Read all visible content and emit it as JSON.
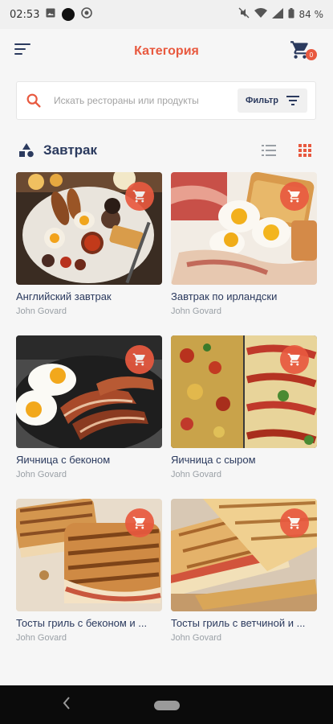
{
  "status_bar": {
    "time": "02:53",
    "battery": "84 %"
  },
  "header": {
    "title": "Категория",
    "cart_count": "0"
  },
  "search": {
    "placeholder": "Искать рестораны или продукты",
    "filter_label": "Фильтр"
  },
  "section": {
    "title": "Завтрак"
  },
  "items": [
    {
      "name": "Английский завтрак",
      "author": "John Govard"
    },
    {
      "name": "Завтрак по ирландски",
      "author": "John Govard"
    },
    {
      "name": "Яичница с беконом",
      "author": "John Govard"
    },
    {
      "name": "Яичница с сыром",
      "author": "John Govard"
    },
    {
      "name": "Тосты гриль с беконом и ...",
      "author": "John Govard"
    },
    {
      "name": "Тосты гриль с ветчиной и ...",
      "author": "John Govard"
    }
  ],
  "colors": {
    "accent": "#e8593f",
    "navy": "#2b3a5e"
  }
}
